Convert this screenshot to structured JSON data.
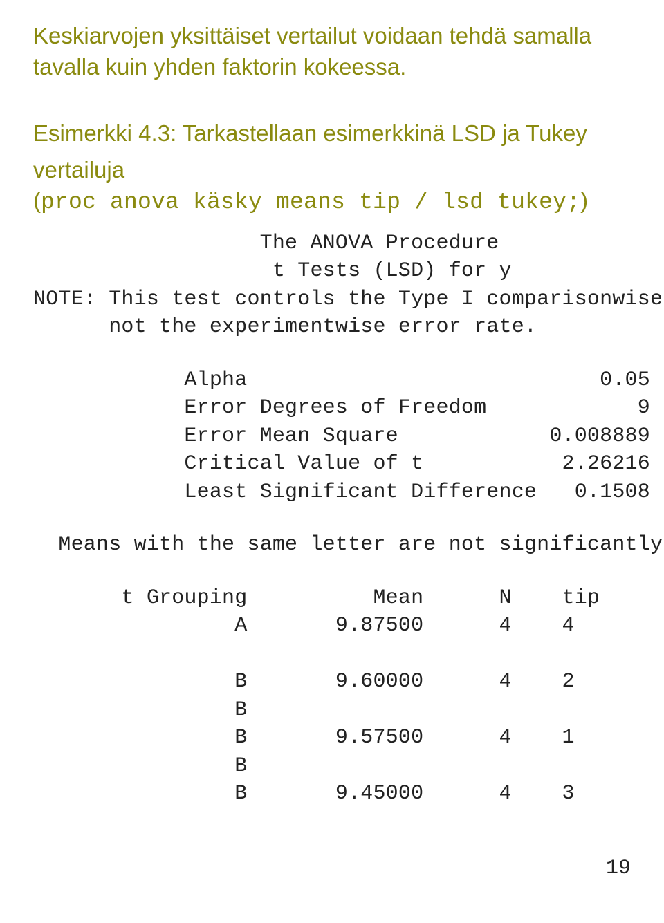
{
  "lead": "Keskiarvojen yksittäiset vertailut voidaan tehdä samalla tavalla kuin yhden faktorin kokeessa.",
  "example": {
    "label": "Esimerkki 4.3",
    "tail1": ": Tarkastellaan esimerkkinä LSD ja Tukey",
    "line2a": "vertailuja (",
    "code": "proc anova käsky means tip / lsd tukey;",
    "line2b": ")"
  },
  "output": {
    "header1": "                  The ANOVA Procedure",
    "header2": "                   t Tests (LSD) for y",
    "note": "NOTE: This test controls the Type I comparisonwise error rate,\n      not the experimentwise error rate.",
    "stats": "            Alpha                            0.05\n            Error Degrees of Freedom            9\n            Error Mean Square            0.008889\n            Critical Value of t           2.26216\n            Least Significant Difference   0.1508",
    "meansnote": "  Means with the same letter are not significantly different.",
    "table": "       t Grouping          Mean      N    tip\n                A       9.87500      4    4\n\n                B       9.60000      4    2\n                B\n                B       9.57500      4    1\n                B\n                B       9.45000      4    3"
  },
  "page": "19"
}
